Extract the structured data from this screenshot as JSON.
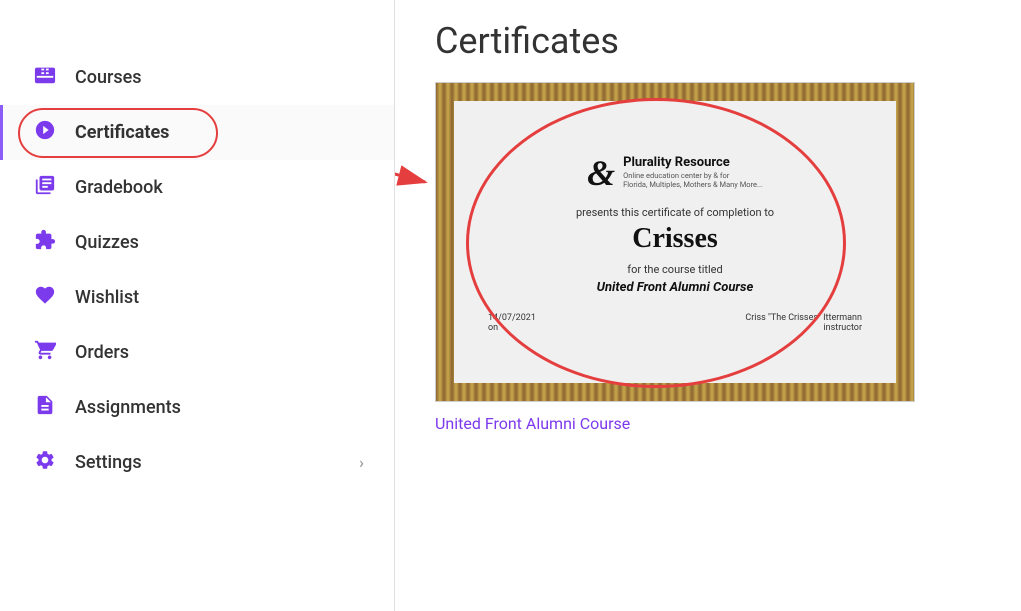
{
  "sidebar": {
    "items": [
      {
        "id": "courses",
        "label": "Courses",
        "icon": "📚"
      },
      {
        "id": "certificates",
        "label": "Certificates",
        "icon": "✳️",
        "active": true
      },
      {
        "id": "gradebook",
        "label": "Gradebook",
        "icon": "🗄️"
      },
      {
        "id": "quizzes",
        "label": "Quizzes",
        "icon": "🧩"
      },
      {
        "id": "wishlist",
        "label": "Wishlist",
        "icon": "♥"
      },
      {
        "id": "orders",
        "label": "Orders",
        "icon": "🛒"
      },
      {
        "id": "assignments",
        "label": "Assignments",
        "icon": "📄"
      },
      {
        "id": "settings",
        "label": "Settings",
        "icon": "⚙️",
        "hasArrow": true
      }
    ]
  },
  "main": {
    "title": "Certificates",
    "certificate": {
      "ampersand": "&",
      "provider": "Plurality Resource",
      "provider_subtitle": "Online education center by & for\nFlorida, Multiple, Mothers & Many More...",
      "presents_text": "presents this certificate of completion to",
      "recipient": "Crisses",
      "for_text": "for the course titled",
      "course_name": "United Front Alumni Course",
      "date": "14/07/2021",
      "date_label": "on",
      "instructor": "Criss \"The Crisses\" Ittermann",
      "instructor_label": "instructor",
      "course_link": "United Front Alumni Course"
    }
  }
}
